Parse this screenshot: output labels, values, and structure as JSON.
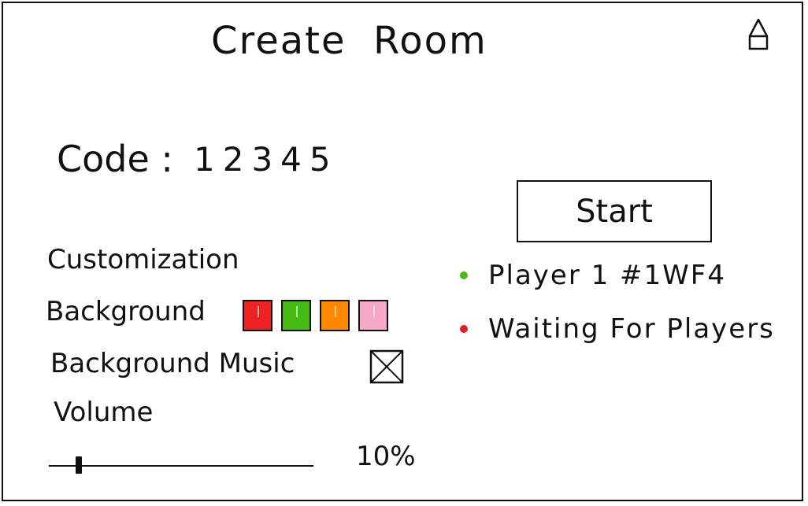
{
  "header": {
    "title": "Create  Room",
    "home_icon": "home-icon"
  },
  "room": {
    "code_label": "Code :",
    "code_value": "12345"
  },
  "customization": {
    "heading": "Customization",
    "background_label": "Background",
    "background_colors": [
      "#ee2222",
      "#44bb11",
      "#ff8800",
      "#f7a8c4"
    ],
    "music_label": "Background Music",
    "music_toggle_icon": "checkbox-x-icon",
    "volume_label": "Volume",
    "volume_value": "10%",
    "volume_level": 0.1
  },
  "actions": {
    "start_label": "Start"
  },
  "players": [
    {
      "status_color": "#44bb11",
      "text": "Player 1 #1WF4"
    },
    {
      "status_color": "#e02020",
      "text": "Waiting For Players"
    }
  ]
}
